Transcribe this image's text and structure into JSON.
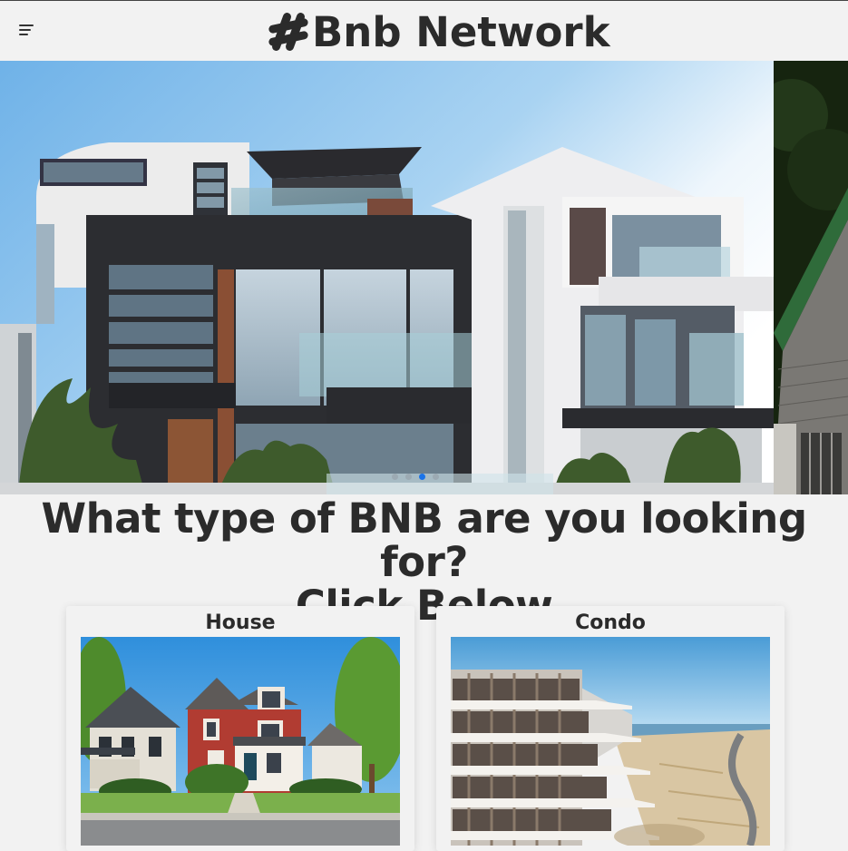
{
  "header": {
    "brand_name": "Bnb Network",
    "brand_icon": "hashtag-icon",
    "menu_icon": "hamburger-menu-icon"
  },
  "carousel": {
    "slide_count": 4,
    "active_index": 2,
    "active_dot_color": "#1a73e8"
  },
  "prompt": {
    "line1": "What type of BNB are you looking for?",
    "line2": "Click Below"
  },
  "categories": [
    {
      "title": "House"
    },
    {
      "title": "Condo"
    }
  ]
}
